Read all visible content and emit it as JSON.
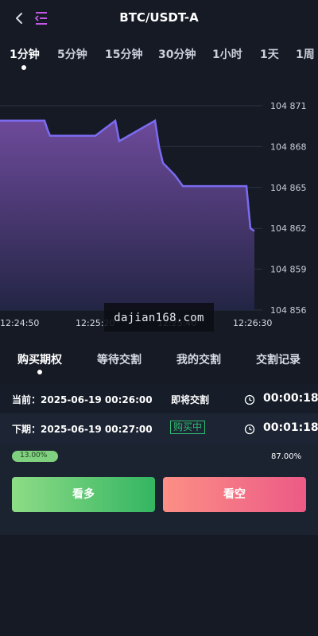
{
  "header": {
    "title": "BTC/USDT-A"
  },
  "intervals": [
    {
      "label": "1分钟",
      "active": true
    },
    {
      "label": "5分钟",
      "active": false
    },
    {
      "label": "15分钟",
      "active": false
    },
    {
      "label": "30分钟",
      "active": false
    },
    {
      "label": "1小时",
      "active": false
    },
    {
      "label": "1天",
      "active": false
    },
    {
      "label": "1周",
      "active": false
    }
  ],
  "chart_data": {
    "type": "area",
    "x": [
      0,
      0.56,
      0.6,
      0.63,
      1.2,
      1.45,
      1.5,
      1.95,
      2.0,
      2.05,
      2.2,
      2.3,
      2.5,
      3.1,
      3.15,
      3.2
    ],
    "y": [
      104869.9,
      104869.9,
      104869.2,
      104868.8,
      104868.8,
      104869.9,
      104868.4,
      104869.9,
      104868.0,
      104866.8,
      104865.9,
      104865.1,
      104865.1,
      104865.1,
      104862.0,
      104861.8
    ],
    "yticks": [
      "104 871",
      "104 868",
      "104 865",
      "104 862",
      "104 859",
      "104 856"
    ],
    "xticks": [
      "12:24:50",
      "12:25:20",
      "12:25:40",
      "12:26:30"
    ],
    "ylim": [
      104856,
      104871
    ],
    "grid": true,
    "colors": {
      "line": "#7b6bf0",
      "fill_top": "#6d4a9a",
      "fill_bottom": "#232545"
    }
  },
  "watermark": "dajian168.com",
  "trade_tabs": [
    {
      "label": "购买期权",
      "active": true
    },
    {
      "label": "等待交割",
      "active": false
    },
    {
      "label": "我的交割",
      "active": false
    },
    {
      "label": "交割记录",
      "active": false
    }
  ],
  "current": {
    "label": "当前：2025-06-19 00:26:00",
    "status": "即将交割",
    "countdown": "00:00:18"
  },
  "next": {
    "label": "下期：2025-06-19 00:27:00",
    "status": "购买中",
    "countdown": "00:01:18"
  },
  "ratio": {
    "long_pct": "13.00%",
    "short_pct": "87.00%",
    "long_value": 0.13
  },
  "buttons": {
    "long": "看多",
    "short": "看空"
  }
}
